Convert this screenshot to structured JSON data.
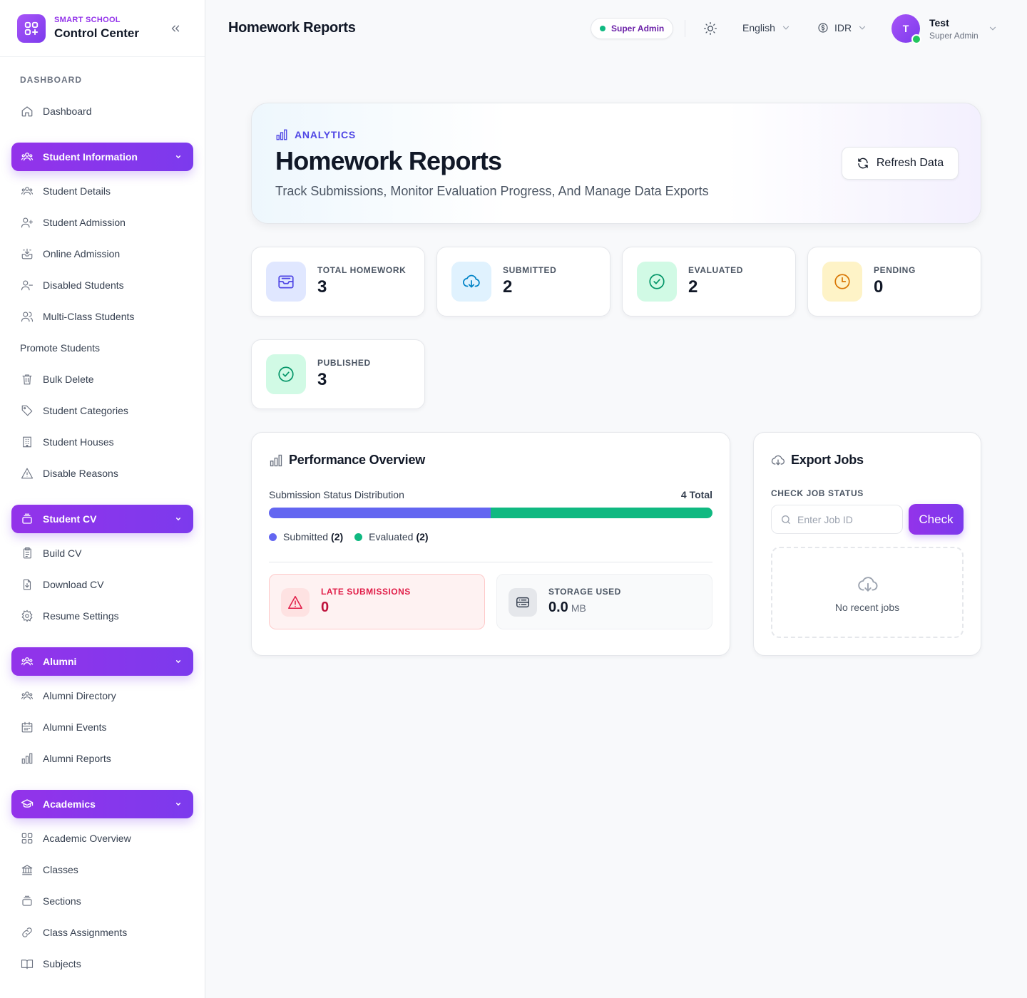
{
  "brand": {
    "subtitle": "SMART SCHOOL",
    "title": "Control Center"
  },
  "sidebar": {
    "section_label": "DASHBOARD",
    "dashboard": "Dashboard",
    "groups": [
      {
        "label": "Student Information",
        "items": [
          "Student Details",
          "Student Admission",
          "Online Admission",
          "Disabled Students",
          "Multi-Class Students",
          "Promote Students",
          "Bulk Delete",
          "Student Categories",
          "Student Houses",
          "Disable Reasons"
        ]
      },
      {
        "label": "Student CV",
        "items": [
          "Build CV",
          "Download CV",
          "Resume Settings"
        ]
      },
      {
        "label": "Alumni",
        "items": [
          "Alumni Directory",
          "Alumni Events",
          "Alumni Reports"
        ]
      },
      {
        "label": "Academics",
        "items": [
          "Academic Overview",
          "Classes",
          "Sections",
          "Class Assignments",
          "Subjects"
        ]
      }
    ]
  },
  "header": {
    "title": "Homework Reports",
    "role_badge": "Super Admin",
    "language": "English",
    "currency": "IDR",
    "user": {
      "initial": "T",
      "name": "Test",
      "role": "Super Admin"
    }
  },
  "hero": {
    "kicker": "ANALYTICS",
    "title": "Homework Reports",
    "description": "Track Submissions, Monitor Evaluation Progress, And Manage Data Exports",
    "refresh_label": "Refresh Data"
  },
  "stats": [
    {
      "label": "TOTAL HOMEWORK",
      "value": "3",
      "icon": "inbox-icon",
      "color": "#4f46e5"
    },
    {
      "label": "SUBMITTED",
      "value": "2",
      "icon": "cloud-download-icon",
      "color": "#0284c7"
    },
    {
      "label": "EVALUATED",
      "value": "2",
      "icon": "check-circle-icon",
      "color": "#059669"
    },
    {
      "label": "PENDING",
      "value": "0",
      "icon": "clock-icon",
      "color": "#d97706"
    },
    {
      "label": "PUBLISHED",
      "value": "3",
      "icon": "check-circle-icon",
      "color": "#059669"
    }
  ],
  "performance": {
    "title": "Performance Overview",
    "distribution_label": "Submission Status Distribution",
    "total_label": "4 Total",
    "segments": [
      {
        "name": "Submitted",
        "count_label": "(2)",
        "value": 2,
        "color": "#6366f1"
      },
      {
        "name": "Evaluated",
        "count_label": "(2)",
        "value": 2,
        "color": "#10b981"
      }
    ],
    "late": {
      "label": "LATE SUBMISSIONS",
      "value": "0"
    },
    "storage": {
      "label": "STORAGE USED",
      "value": "0.0",
      "unit": "MB"
    }
  },
  "export": {
    "title": "Export Jobs",
    "check_label": "CHECK JOB STATUS",
    "input_placeholder": "Enter Job ID",
    "check_button": "Check",
    "empty_text": "No recent jobs"
  }
}
